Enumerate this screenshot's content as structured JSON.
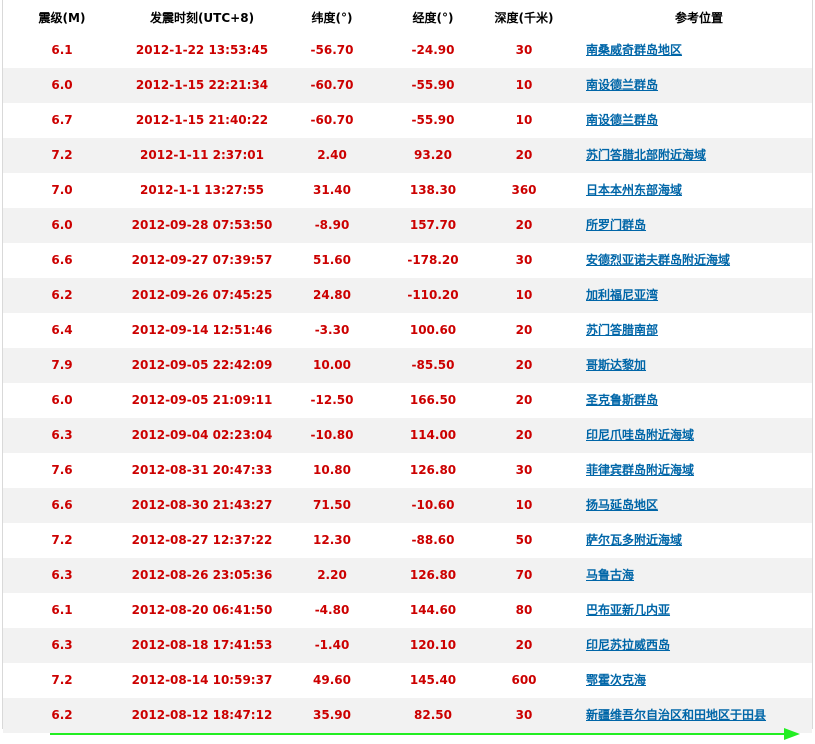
{
  "table": {
    "headers": {
      "magnitude": "震级(M)",
      "time": "发震时刻(UTC+8)",
      "latitude": "纬度(°)",
      "longitude": "经度(°)",
      "depth": "深度(千米)",
      "location": "参考位置"
    },
    "rows": [
      {
        "magnitude": "6.1",
        "time": "2012-1-22 13:53:45",
        "latitude": "-56.70",
        "longitude": "-24.90",
        "depth": "30",
        "location": "南桑威奇群岛地区"
      },
      {
        "magnitude": "6.0",
        "time": "2012-1-15 22:21:34",
        "latitude": "-60.70",
        "longitude": "-55.90",
        "depth": "10",
        "location": "南设德兰群岛"
      },
      {
        "magnitude": "6.7",
        "time": "2012-1-15 21:40:22",
        "latitude": "-60.70",
        "longitude": "-55.90",
        "depth": "10",
        "location": "南设德兰群岛"
      },
      {
        "magnitude": "7.2",
        "time": "2012-1-11 2:37:01",
        "latitude": "2.40",
        "longitude": "93.20",
        "depth": "20",
        "location": "苏门答腊北部附近海域"
      },
      {
        "magnitude": "7.0",
        "time": "2012-1-1 13:27:55",
        "latitude": "31.40",
        "longitude": "138.30",
        "depth": "360",
        "location": "日本本州东部海域"
      },
      {
        "magnitude": "6.0",
        "time": "2012-09-28 07:53:50",
        "latitude": "-8.90",
        "longitude": "157.70",
        "depth": "20",
        "location": "所罗门群岛"
      },
      {
        "magnitude": "6.6",
        "time": "2012-09-27 07:39:57",
        "latitude": "51.60",
        "longitude": "-178.20",
        "depth": "30",
        "location": "安德烈亚诺夫群岛附近海域"
      },
      {
        "magnitude": "6.2",
        "time": "2012-09-26 07:45:25",
        "latitude": "24.80",
        "longitude": "-110.20",
        "depth": "10",
        "location": "加利福尼亚湾"
      },
      {
        "magnitude": "6.4",
        "time": "2012-09-14 12:51:46",
        "latitude": "-3.30",
        "longitude": "100.60",
        "depth": "20",
        "location": "苏门答腊南部"
      },
      {
        "magnitude": "7.9",
        "time": "2012-09-05 22:42:09",
        "latitude": "10.00",
        "longitude": "-85.50",
        "depth": "20",
        "location": "哥斯达黎加"
      },
      {
        "magnitude": "6.0",
        "time": "2012-09-05 21:09:11",
        "latitude": "-12.50",
        "longitude": "166.50",
        "depth": "20",
        "location": "圣克鲁斯群岛"
      },
      {
        "magnitude": "6.3",
        "time": "2012-09-04 02:23:04",
        "latitude": "-10.80",
        "longitude": "114.00",
        "depth": "20",
        "location": "印尼爪哇岛附近海域"
      },
      {
        "magnitude": "7.6",
        "time": "2012-08-31 20:47:33",
        "latitude": "10.80",
        "longitude": "126.80",
        "depth": "30",
        "location": "菲律宾群岛附近海域"
      },
      {
        "magnitude": "6.6",
        "time": "2012-08-30 21:43:27",
        "latitude": "71.50",
        "longitude": "-10.60",
        "depth": "10",
        "location": "扬马延岛地区"
      },
      {
        "magnitude": "7.2",
        "time": "2012-08-27 12:37:22",
        "latitude": "12.30",
        "longitude": "-88.60",
        "depth": "50",
        "location": "萨尔瓦多附近海域"
      },
      {
        "magnitude": "6.3",
        "time": "2012-08-26 23:05:36",
        "latitude": "2.20",
        "longitude": "126.80",
        "depth": "70",
        "location": "马鲁古海"
      },
      {
        "magnitude": "6.1",
        "time": "2012-08-20 06:41:50",
        "latitude": "-4.80",
        "longitude": "144.60",
        "depth": "80",
        "location": "巴布亚新几内亚"
      },
      {
        "magnitude": "6.3",
        "time": "2012-08-18 17:41:53",
        "latitude": "-1.40",
        "longitude": "120.10",
        "depth": "20",
        "location": "印尼苏拉威西岛"
      },
      {
        "magnitude": "7.2",
        "time": "2012-08-14 10:59:37",
        "latitude": "49.60",
        "longitude": "145.40",
        "depth": "600",
        "location": "鄂霍次克海"
      },
      {
        "magnitude": "6.2",
        "time": "2012-08-12 18:47:12",
        "latitude": "35.90",
        "longitude": "82.50",
        "depth": "30",
        "location": "新疆维吾尔自治区和田地区于田县"
      }
    ]
  },
  "colors": {
    "value_text": "#cc0000",
    "link_text": "#0066a8",
    "header_text": "#000000",
    "alt_row_bg": "#f2f2f2",
    "arrow": "#22ee22"
  }
}
